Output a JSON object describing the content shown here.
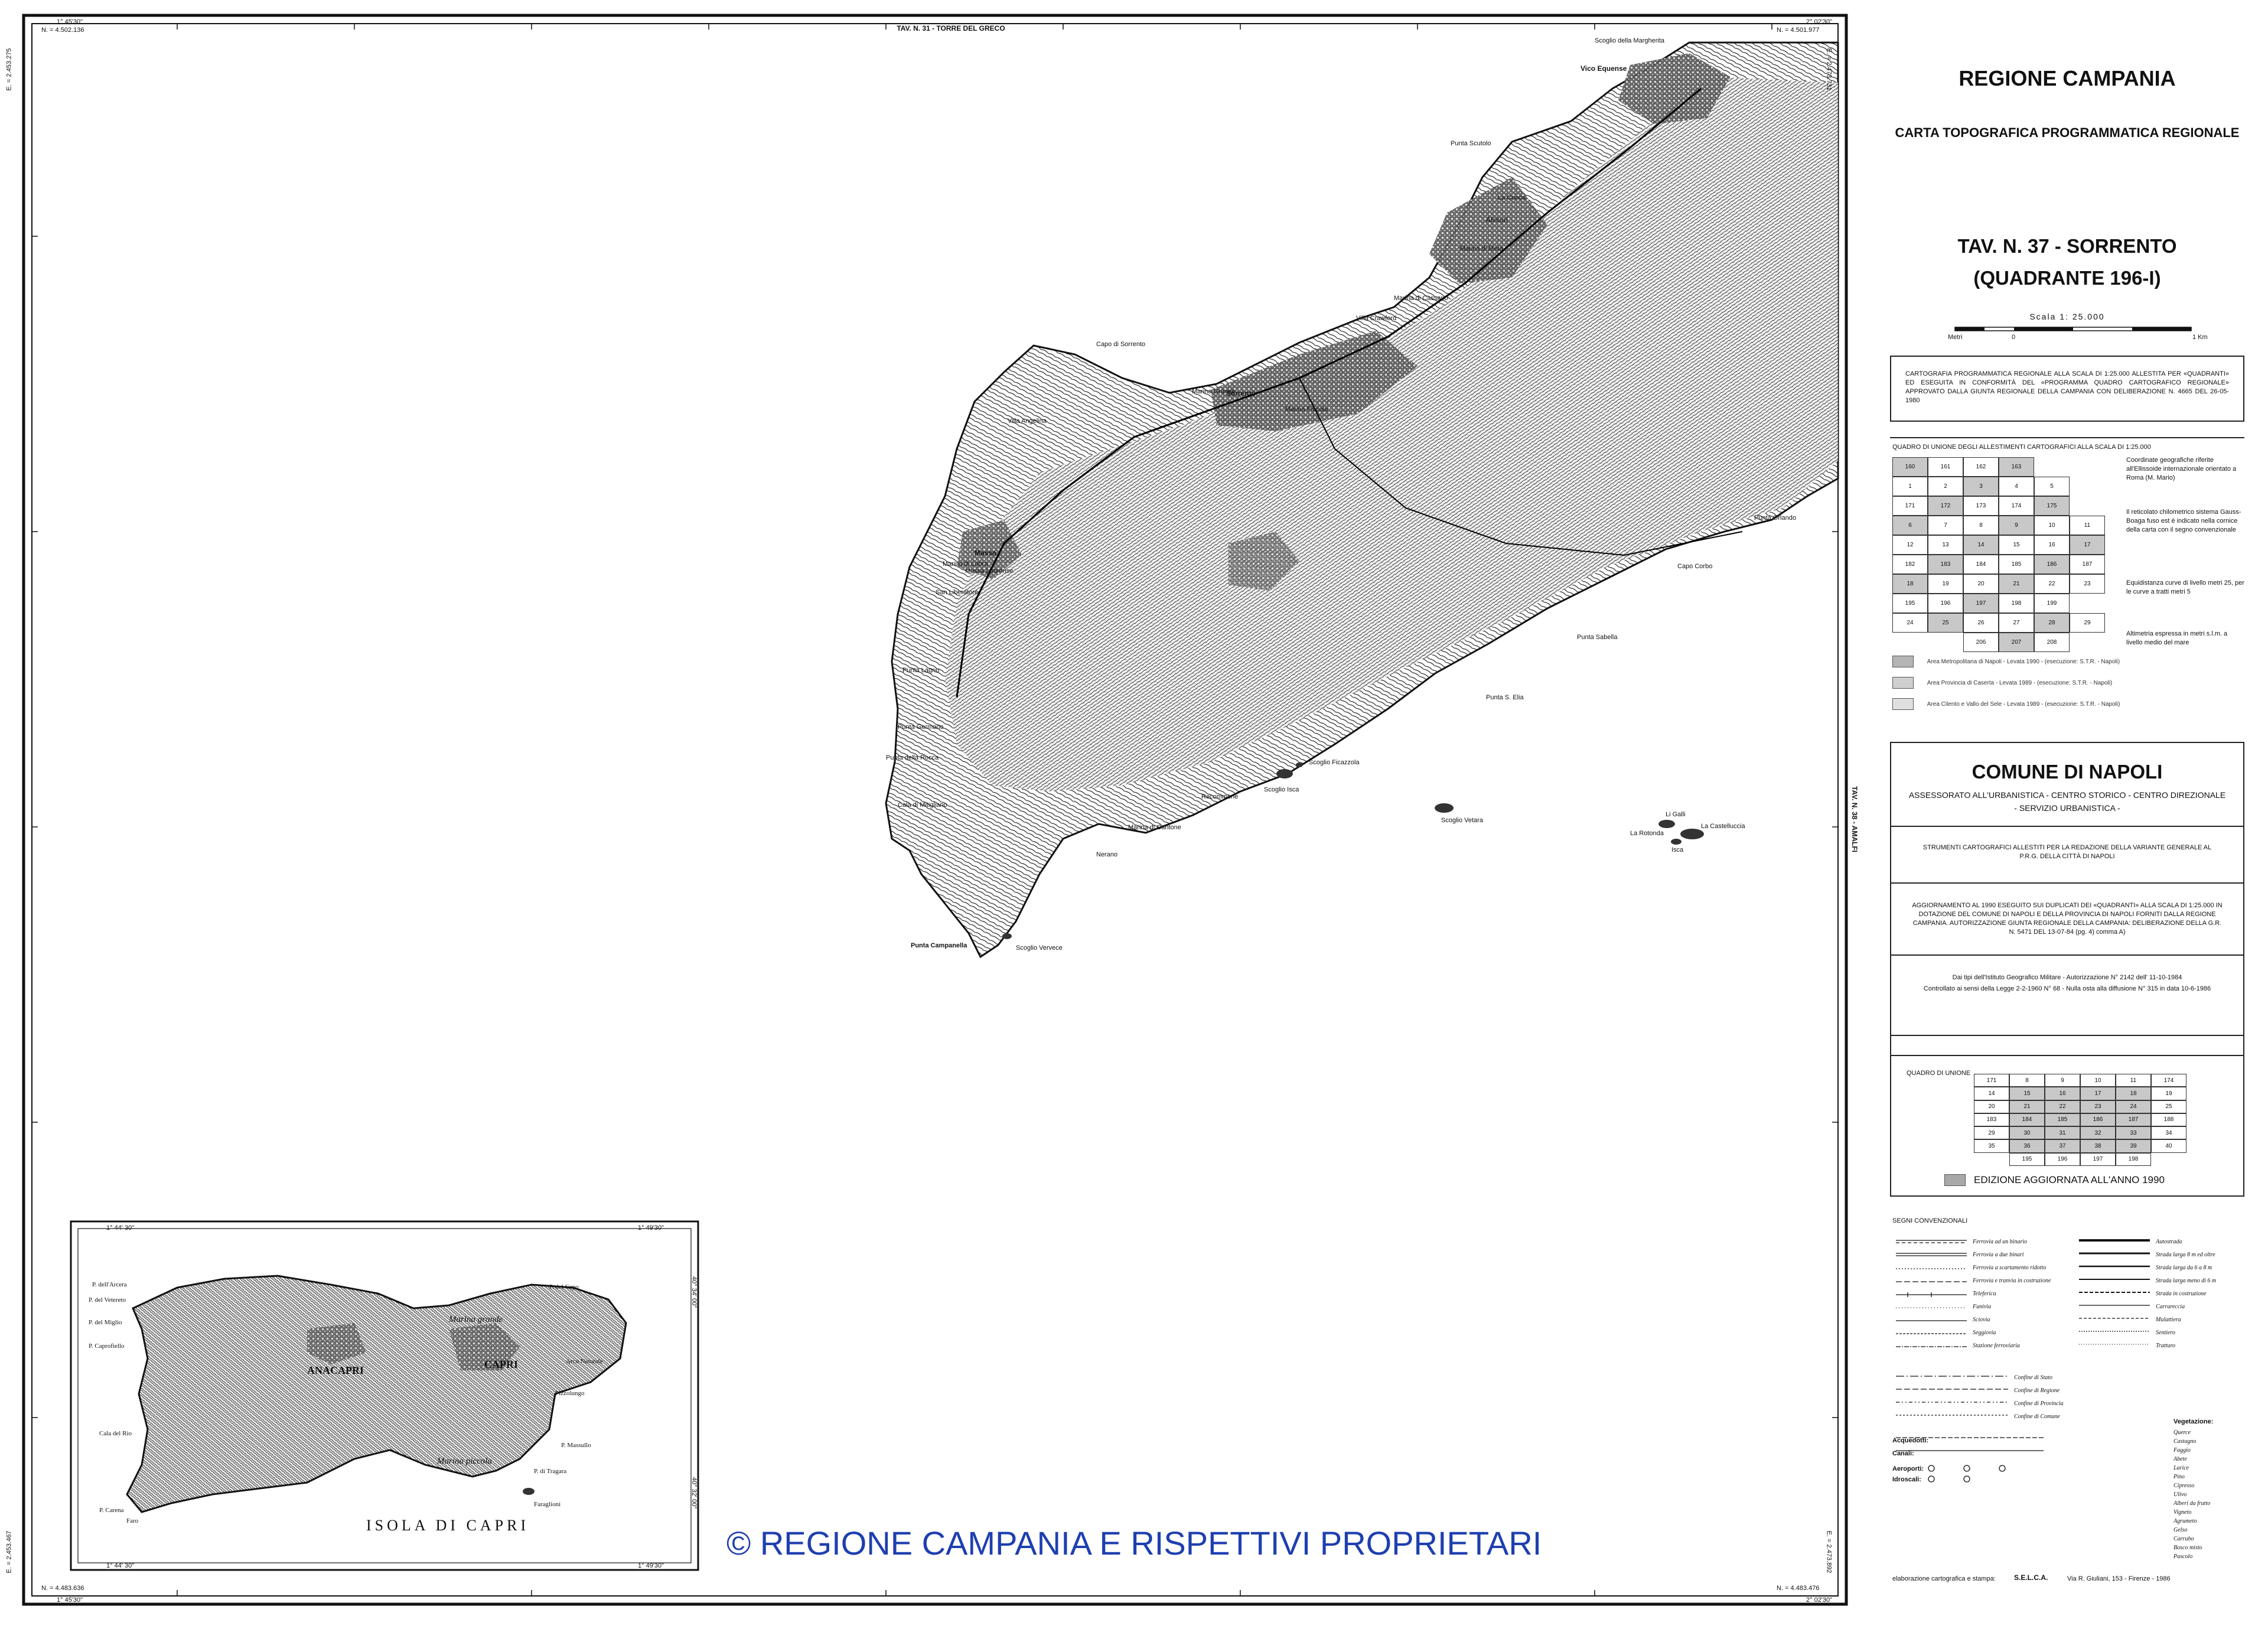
{
  "map_frame": {
    "top_center": "TAV. N. 31 - TORRE DEL GRECO",
    "right_center": "TAV. N. 38 - AMALFI",
    "corner_tl_deg": "1° 45'30\"",
    "corner_tl_n": "N. = 4.502.136",
    "corner_tr_deg": "2° 02'30\"",
    "corner_tr_n": "N. = 4.501.977",
    "corner_bl_deg": "1° 45'30\"",
    "corner_bl_n": "N. = 4.483.636",
    "corner_br_deg": "2° 02'30\"",
    "corner_br_n": "N. = 4.483.476",
    "left_side_top": "E. = 2.453.275",
    "left_side_bottom": "E. = 2.453.467",
    "right_side_top": "E. = 2.473.731",
    "right_side_bottom": "E. = 2.473.892"
  },
  "place_labels": {
    "vico": "Vico Equense",
    "scoglio": "Scoglio della Margherita",
    "punta_scutolo": "Punta Scutolo",
    "alimuri": "Alimuri",
    "marina_meta": "Marina di Meta",
    "la_conca": "La Conca",
    "marina_cassano": "Marina di Cassano",
    "villa_crawford": "Villa Crawford",
    "sorrento": "Sorrento",
    "marina_piccola": "Marina Piccola",
    "marina_grande": "Marina Grande",
    "capo_sorrento": "Capo di Sorrento",
    "villa_angelina": "Villa Angelina",
    "massa": "Massa",
    "massa_lubrense": "Massa Lubrense",
    "marina_lobra": "Marina di Lobra",
    "marina_cantone": "Marina di Cantone",
    "punta_campanella": "Punta Campanella",
    "scoglio_vervece": "Scoglio Vervece",
    "li_galli": "Li Galli",
    "la_rotonda": "La Rotonda",
    "la_castelluccia": "La Castelluccia",
    "isca": "Isca",
    "scoglio_vetara": "Scoglio Vetara",
    "punta_orlando": "Punta Orlando",
    "marina_recommone": "Recommone",
    "scoglio_ficazzola": "Scoglio Ficazzola",
    "punta_lagno": "Punta Lagno",
    "cala_mitigliano": "Cala di Mitigliano",
    "punta_germano": "Punta Germano",
    "capo_corbo": "Capo Corbo",
    "punta_sabella": "Punta Sabella",
    "punta_della_rocca": "Punta della Rocca",
    "marina_del_cantone": "Nerano",
    "san_liberatore": "San Liberatore",
    "punta_s_elia": "Punta S. Elia",
    "scoglio_isca": "Scoglio Isca"
  },
  "capri_inset": {
    "title": "ISOLA DI CAPRI",
    "deg_tl": "1° 44' 30\"",
    "deg_tr": "1° 49'30\"",
    "deg_bl": "1° 44' 30\"",
    "deg_br": "1° 49'30\"",
    "lat_top": "40° 34' 00\"",
    "lat_bottom": "40° 32' 00\"",
    "labels": {
      "anacapri": "ANACAPRI",
      "capri": "CAPRI",
      "marina_grande": "Marina grande",
      "marina_piccola": "Marina piccola",
      "p_arcera": "P. dell'Arcera",
      "p_vetereto": "P. del Vetereto",
      "p_miglio": "P. del Miglio",
      "p_capo": "P. del Capo",
      "p_carena": "P. Carena",
      "p_tragara": "P. di Tragara",
      "caprile": "P. Caprofiello",
      "calamadonna": "Cala del Rio",
      "faro": "Faro",
      "pizzolungo": "Pizzolungo",
      "punta_massullo": "P. Massullo",
      "faraglioni": "Faraglioni",
      "matermania": "Arco Naturale"
    }
  },
  "watermark": "© REGIONE CAMPANIA E RISPETTIVI PROPRIETARI",
  "sidebar": {
    "region": "REGIONE CAMPANIA",
    "subtitle": "CARTA TOPOGRAFICA PROGRAMMATICA REGIONALE",
    "tav": "TAV. N. 37 - SORRENTO",
    "quadrante": "(QUADRANTE 196-I)",
    "scale_label": "Scala 1: 25.000",
    "scale_ticks": [
      "Metri",
      "0",
      "1 Km"
    ],
    "box1_text": "CARTOGRAFIA PROGRAMMATICA REGIONALE ALLA SCALA DI 1:25.000 ALLESTITA PER «QUADRANTI» ED ESEGUITA IN CONFORMITÀ DEL «PROGRAMMA QUADRO CARTOGRAFICO REGIONALE» APPROVATO DALLA GIUNTA REGIONALE DELLA CAMPANIA CON DELIBERAZIONE N. 4665 DEL 26-05-1980",
    "quadro_title": "QUADRO DI UNIONE DEGLI ALLESTIMENTI CARTOGRAFICI ALLA SCALA DI 1:25.000",
    "quadro_notes": [
      "Coordinate geografiche riferite all'Ellissoide internazionale orientato a Roma (M. Mario)",
      "Il reticolato chilometrico sistema Gauss-Boaga fuso est è indicato nella cornice della carta con il segno convenzionale",
      "Equidistanza curve di livello metri 25, per le curve a tratti metri 5",
      "Altimetria espressa in metri s.l.m. a livello medio del mare"
    ],
    "quadro_grid": [
      [
        "160",
        "161",
        "162",
        "163",
        "",
        ""
      ],
      [
        "1",
        "2",
        "3",
        "4",
        "5",
        ""
      ],
      [
        "171",
        "172",
        "173",
        "174",
        "175",
        ""
      ],
      [
        "6",
        "7",
        "8",
        "9",
        "10",
        "11"
      ],
      [
        "12",
        "13",
        "14",
        "15",
        "16",
        "17"
      ],
      [
        "182",
        "183",
        "184",
        "185",
        "186",
        "187"
      ],
      [
        "18",
        "19",
        "20",
        "21",
        "22",
        "23"
      ],
      [
        "195",
        "196",
        "197",
        "198",
        "199",
        ""
      ],
      [
        "24",
        "25",
        "26",
        "27",
        "28",
        "29"
      ],
      [
        "",
        "",
        "206",
        "207",
        "208",
        ""
      ]
    ],
    "legend_items": [
      "Area Metropolitana di Napoli - Levata 1990 - (esecuzione: S.T.R. - Napoli)",
      "Area Provincia di Caserta - Levata 1989 - (esecuzione: S.T.R. - Napoli)",
      "Area Cilento e Vallo del Sele - Levata 1989 - (esecuzione: S.T.R. - Napoli)"
    ],
    "comune": "COMUNE DI NAPOLI",
    "assessorato": "ASSESSORATO ALL'URBANISTICA - CENTRO STORICO - CENTRO DIREZIONALE",
    "servizio": "- SERVIZIO URBANISTICA -",
    "strumenti": "STRUMENTI CARTOGRAFICI ALLESTITI PER LA REDAZIONE DELLA VARIANTE GENERALE AL P.R.G. DELLA CITTÀ DI NAPOLI",
    "aggiornamento": "AGGIORNAMENTO AL 1990 ESEGUITO SUI DUPLICATI DEI «QUADRANTI» ALLA SCALA DI 1:25.000 IN DOTAZIONE DEL COMUNE DI NAPOLI E DELLA PROVINCIA DI NAPOLI FORNITI DALLA REGIONE CAMPANIA. AUTORIZZAZIONE GIUNTA REGIONALE DELLA CAMPANIA: DELIBERAZIONE DELLA G.R. N. 5471 DEL 13-07-84 (pg. 4) comma A)",
    "tipi": "Dai tipi dell'Istituto Geografico Militare - Autorizzazione N° 2142 dell' 11-10-1984",
    "controllato": "Controllato ai sensi della Legge 2-2-1960 N° 68 - Nulla osta alla diffusione N° 315 in data 10-6-1986",
    "quadro2_title": "QUADRO DI UNIONE",
    "quadro2_grid": [
      [
        "171",
        "8",
        "9",
        "10",
        "11",
        "174"
      ],
      [
        "14",
        "15",
        "16",
        "17",
        "18",
        "19"
      ],
      [
        "20",
        "21",
        "22",
        "23",
        "24",
        "25"
      ],
      [
        "183",
        "184",
        "185",
        "186",
        "187",
        "188"
      ],
      [
        "29",
        "30",
        "31",
        "32",
        "33",
        "34"
      ],
      [
        "35",
        "36",
        "37",
        "38",
        "39",
        "40"
      ],
      [
        "",
        "195",
        "196",
        "197",
        "198",
        ""
      ]
    ],
    "edizione": "EDIZIONE AGGIORNATA ALL'ANNO 1990",
    "segni_title": "SEGNI CONVENZIONALI",
    "segni_left": [
      "Ferrovia ad un binario",
      "Ferrovia a due binari",
      "Ferrovia a scartamento ridotto",
      "Ferrovia e tranvia in costruzione",
      "Teleferica",
      "Funivia",
      "Sciovia",
      "Seggiovia",
      "Stazione ferroviaria"
    ],
    "segni_right": [
      "Autostrada",
      "Strada larga 8 m ed oltre",
      "Strada larga da 6 a 8 m",
      "Strada larga meno di 6 m",
      "Strada in costruzione",
      "Carrareccia",
      "Mulattiera",
      "Sentiero",
      "Tratturo"
    ],
    "vegetazione_title": "Vegetazione:",
    "vegetazione": [
      "Querce",
      "Castagno",
      "Faggio",
      "Abete",
      "Larice",
      "Pino",
      "Cipresso",
      "Ulivo",
      "Alberi da frutto",
      "Vigneto",
      "Agrumeto",
      "Gelso",
      "Carrubo",
      "Bosco misto",
      "Pascolo"
    ],
    "mid_text": [
      "Confine di Stato",
      "Confine di Regione",
      "Confine di Provincia",
      "Confine di Comune"
    ],
    "acquedotti": "Acquedotti:",
    "canali": "Canali:",
    "aeroporti": "Aeroporti:",
    "idrosc": "Idroscali:",
    "printer_left": "elaborazione cartografica e stampa:",
    "printer_name": "S.E.L.C.A.",
    "printer_addr": "Via R. Giuliani, 153 - Firenze - 1986"
  },
  "colors": {
    "ink": "#111111",
    "hatch": "#444444",
    "shade": "#b5b5b5",
    "watermark": "#1e3fb0"
  }
}
